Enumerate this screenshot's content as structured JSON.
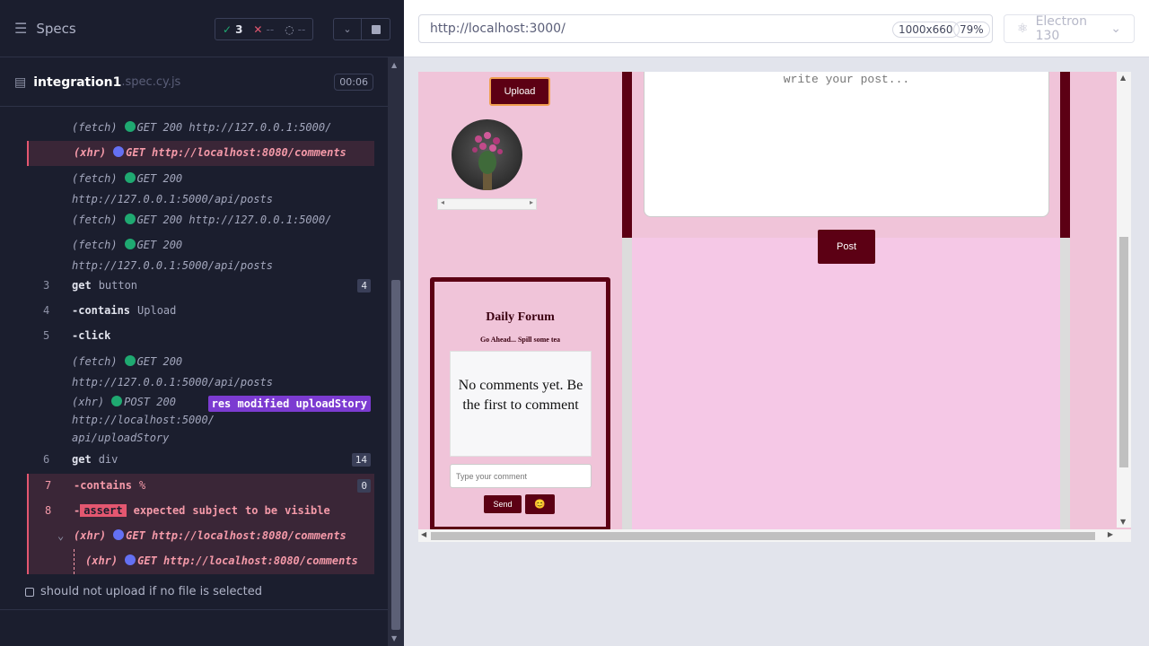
{
  "reporter": {
    "specs_label": "Specs",
    "stats": {
      "passed": "3",
      "failed": "--",
      "pending": "--"
    },
    "spec_name": "integration1",
    "spec_ext": ".spec.cy.js",
    "duration": "00:06",
    "commands": [
      {
        "kind": "(fetch)",
        "status_dot": "green",
        "method": "GET 200",
        "url": "http://127.0.0.1:5000/"
      },
      {
        "kind": "(xhr)",
        "status_dot": "blue",
        "method": "GET",
        "url": "http://localhost:8080/comments",
        "highlight": true
      },
      {
        "kind": "(fetch)",
        "status_dot": "green",
        "method": "GET 200",
        "url": "http://127.0.0.1:5000/api/posts"
      },
      {
        "kind": "(fetch)",
        "status_dot": "green",
        "method": "GET 200",
        "url": "http://127.0.0.1:5000/"
      },
      {
        "kind": "(fetch)",
        "status_dot": "green",
        "method": "GET 200",
        "url": "http://127.0.0.1:5000/api/posts"
      },
      {
        "num": "3",
        "name": "get",
        "arg": "button",
        "count": "4"
      },
      {
        "num": "4",
        "name": "-contains",
        "arg": "Upload"
      },
      {
        "num": "5",
        "name": "-click",
        "arg": ""
      },
      {
        "kind": "(fetch)",
        "status_dot": "green",
        "method": "GET 200",
        "url": "http://127.0.0.1:5000/api/posts"
      },
      {
        "kind": "(xhr)",
        "status_dot": "green",
        "method": "POST 200",
        "url_line1": "http://localhost:5000/",
        "url_line2": "api/uploadStory",
        "badge": "res modified uploadStory"
      },
      {
        "num": "6",
        "name": "get",
        "arg": "div",
        "count": "14"
      },
      {
        "num": "7",
        "name": "-contains",
        "arg": "%",
        "count": "0",
        "highlight": true
      },
      {
        "num": "8",
        "name": "-",
        "assert_tag": "assert",
        "words": [
          "expected",
          "subject",
          "to be",
          "visible"
        ],
        "highlight": true
      },
      {
        "kind": "(xhr)",
        "status_dot": "blue",
        "method": "GET",
        "url": "http://localhost:8080/comments",
        "highlight": true,
        "caret": "⌄"
      },
      {
        "kind": "(xhr)",
        "status_dot": "blue",
        "method": "GET",
        "url": "http://localhost:8080/comments",
        "highlight": true
      }
    ],
    "next_test": "should not upload if no file is selected"
  },
  "aut": {
    "url": "http://localhost:3000/",
    "viewport_size": "1000x660",
    "zoom": "79%",
    "browser": "Electron 130",
    "app": {
      "upload_label": "Upload",
      "post_placeholder": "write your post...",
      "post_label": "Post",
      "forum_title": "Daily Forum",
      "forum_subtitle": "Go Ahead... Spill some tea",
      "no_comments": "No comments yet. Be the first to comment",
      "comment_placeholder": "Type your comment",
      "send_label": "Send",
      "emoji": "😊"
    }
  }
}
